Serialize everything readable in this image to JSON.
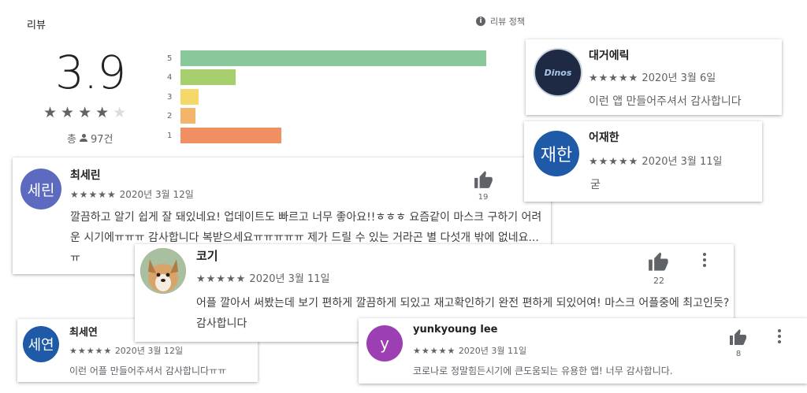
{
  "header": {
    "title": "리뷰",
    "policy_label": "리뷰 정책",
    "info_icon": "i"
  },
  "summary": {
    "score": "3.9",
    "stars_filled": 4,
    "stars_total": 5,
    "stars_text": "★★★★",
    "stars_off_text": "★",
    "total_prefix": "총",
    "total_count": "97건"
  },
  "distribution": [
    {
      "label": "5",
      "fraction": 1.0,
      "color": "#88c89a"
    },
    {
      "label": "4",
      "fraction": 0.18,
      "color": "#a8cf6e"
    },
    {
      "label": "3",
      "fraction": 0.06,
      "color": "#f5d86a"
    },
    {
      "label": "2",
      "fraction": 0.05,
      "color": "#f3b56a"
    },
    {
      "label": "1",
      "fraction": 0.33,
      "color": "#ef8f62"
    }
  ],
  "reviews": [
    {
      "name": "최세린",
      "avatar_text": "세린",
      "avatar_color": "#5c6bc0",
      "stars": "★★★★★",
      "date": "2020년 3월 12일",
      "text": "깔끔하고 알기 쉽게 잘 돼있네요! 업데이트도 빠르고 너무 좋아요!!ㅎㅎㅎ 요즘같이 마스크 구하기 어려운 시기에ㅠㅠㅠ 감사합니다 복받으세요ㅠㅠㅠㅠㅠ 제가 드릴 수 있는 거라곤 별 다섯개 밖에 없네요...ㅠ",
      "likes": "19"
    },
    {
      "name": "대거에릭",
      "avatar_text": "Dinos",
      "avatar_color": "#1e2a44",
      "stars": "★★★★★",
      "date": "2020년 3월 6일",
      "text": "이런 앱 만들어주셔서 감사합니다"
    },
    {
      "name": "어재한",
      "avatar_text": "재한",
      "avatar_color": "#1e5aa8",
      "stars": "★★★★★",
      "date": "2020년 3월 11일",
      "text": "굳"
    },
    {
      "name": "코기",
      "avatar_text": "",
      "avatar_color": "#c99a6a",
      "stars": "★★★★★",
      "date": "2020년 3월 11일",
      "text": "어플 깔아서 써봤는데 보기 편하게 깔끔하게 되있고 재고확인하기 완전 편하게 되있어여! 마스크 어플중에 최고인듯? 감사합니다",
      "likes": "22"
    },
    {
      "name": "최세연",
      "avatar_text": "세연",
      "avatar_color": "#1e5aa8",
      "stars": "★★★★★",
      "date": "2020년 3월 12일",
      "text": "이런 어플 만들어주셔서 감사합니다ㅠㅠ"
    },
    {
      "name": "yunkyoung lee",
      "avatar_text": "y",
      "avatar_color": "#9c3fb3",
      "stars": "★★★★★",
      "date": "2020년 3월 11일",
      "text": "코로나로 정말힘든시기에 큰도움되는 유용한 앱! 너무 감사합니다.",
      "likes": "8"
    }
  ]
}
